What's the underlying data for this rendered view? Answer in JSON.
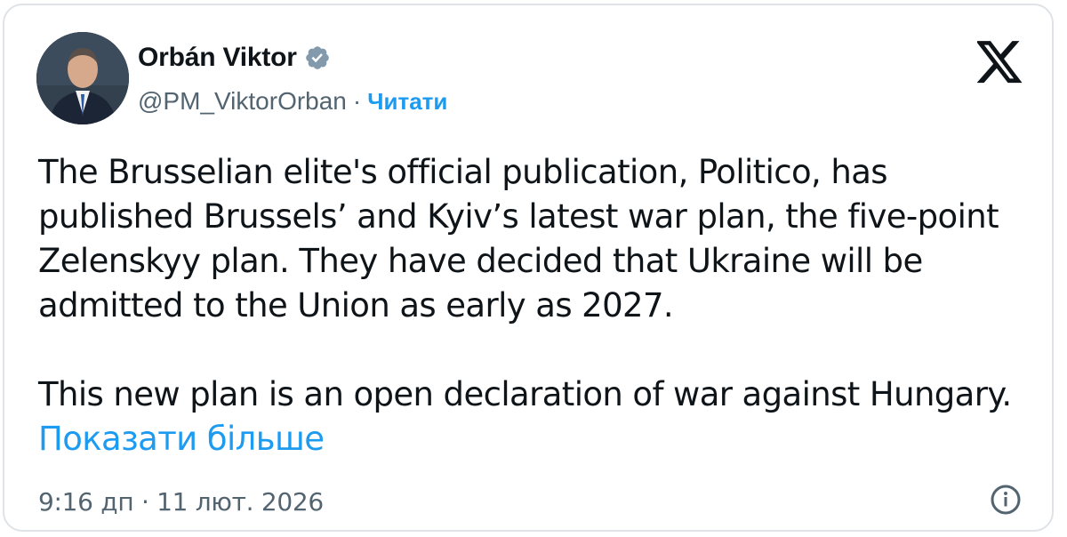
{
  "author": {
    "name": "Orbán Viktor",
    "handle": "@PM_ViktorOrban",
    "separator": "·",
    "follow_label": "Читати"
  },
  "tweet": {
    "paragraph_1": "The Brusselian elite's official publication, Politico, has published Brussels’ and Kyiv’s latest war plan, the five-point Zelenskyy plan. They have decided that Ukraine will be admitted to the Union as early as 2027.",
    "paragraph_2": "This new plan is an open declaration of war against Hungary. ",
    "show_more": "Показати більше",
    "timestamp": "9:16 дп · 11 лют. 2026"
  },
  "icons": {
    "verified": "verified-badge-icon",
    "logo": "x-logo-icon",
    "info": "info-icon"
  },
  "colors": {
    "text": "#0f1419",
    "secondary": "#536471",
    "accent": "#1d9bf0",
    "border": "#dfe3e7"
  }
}
